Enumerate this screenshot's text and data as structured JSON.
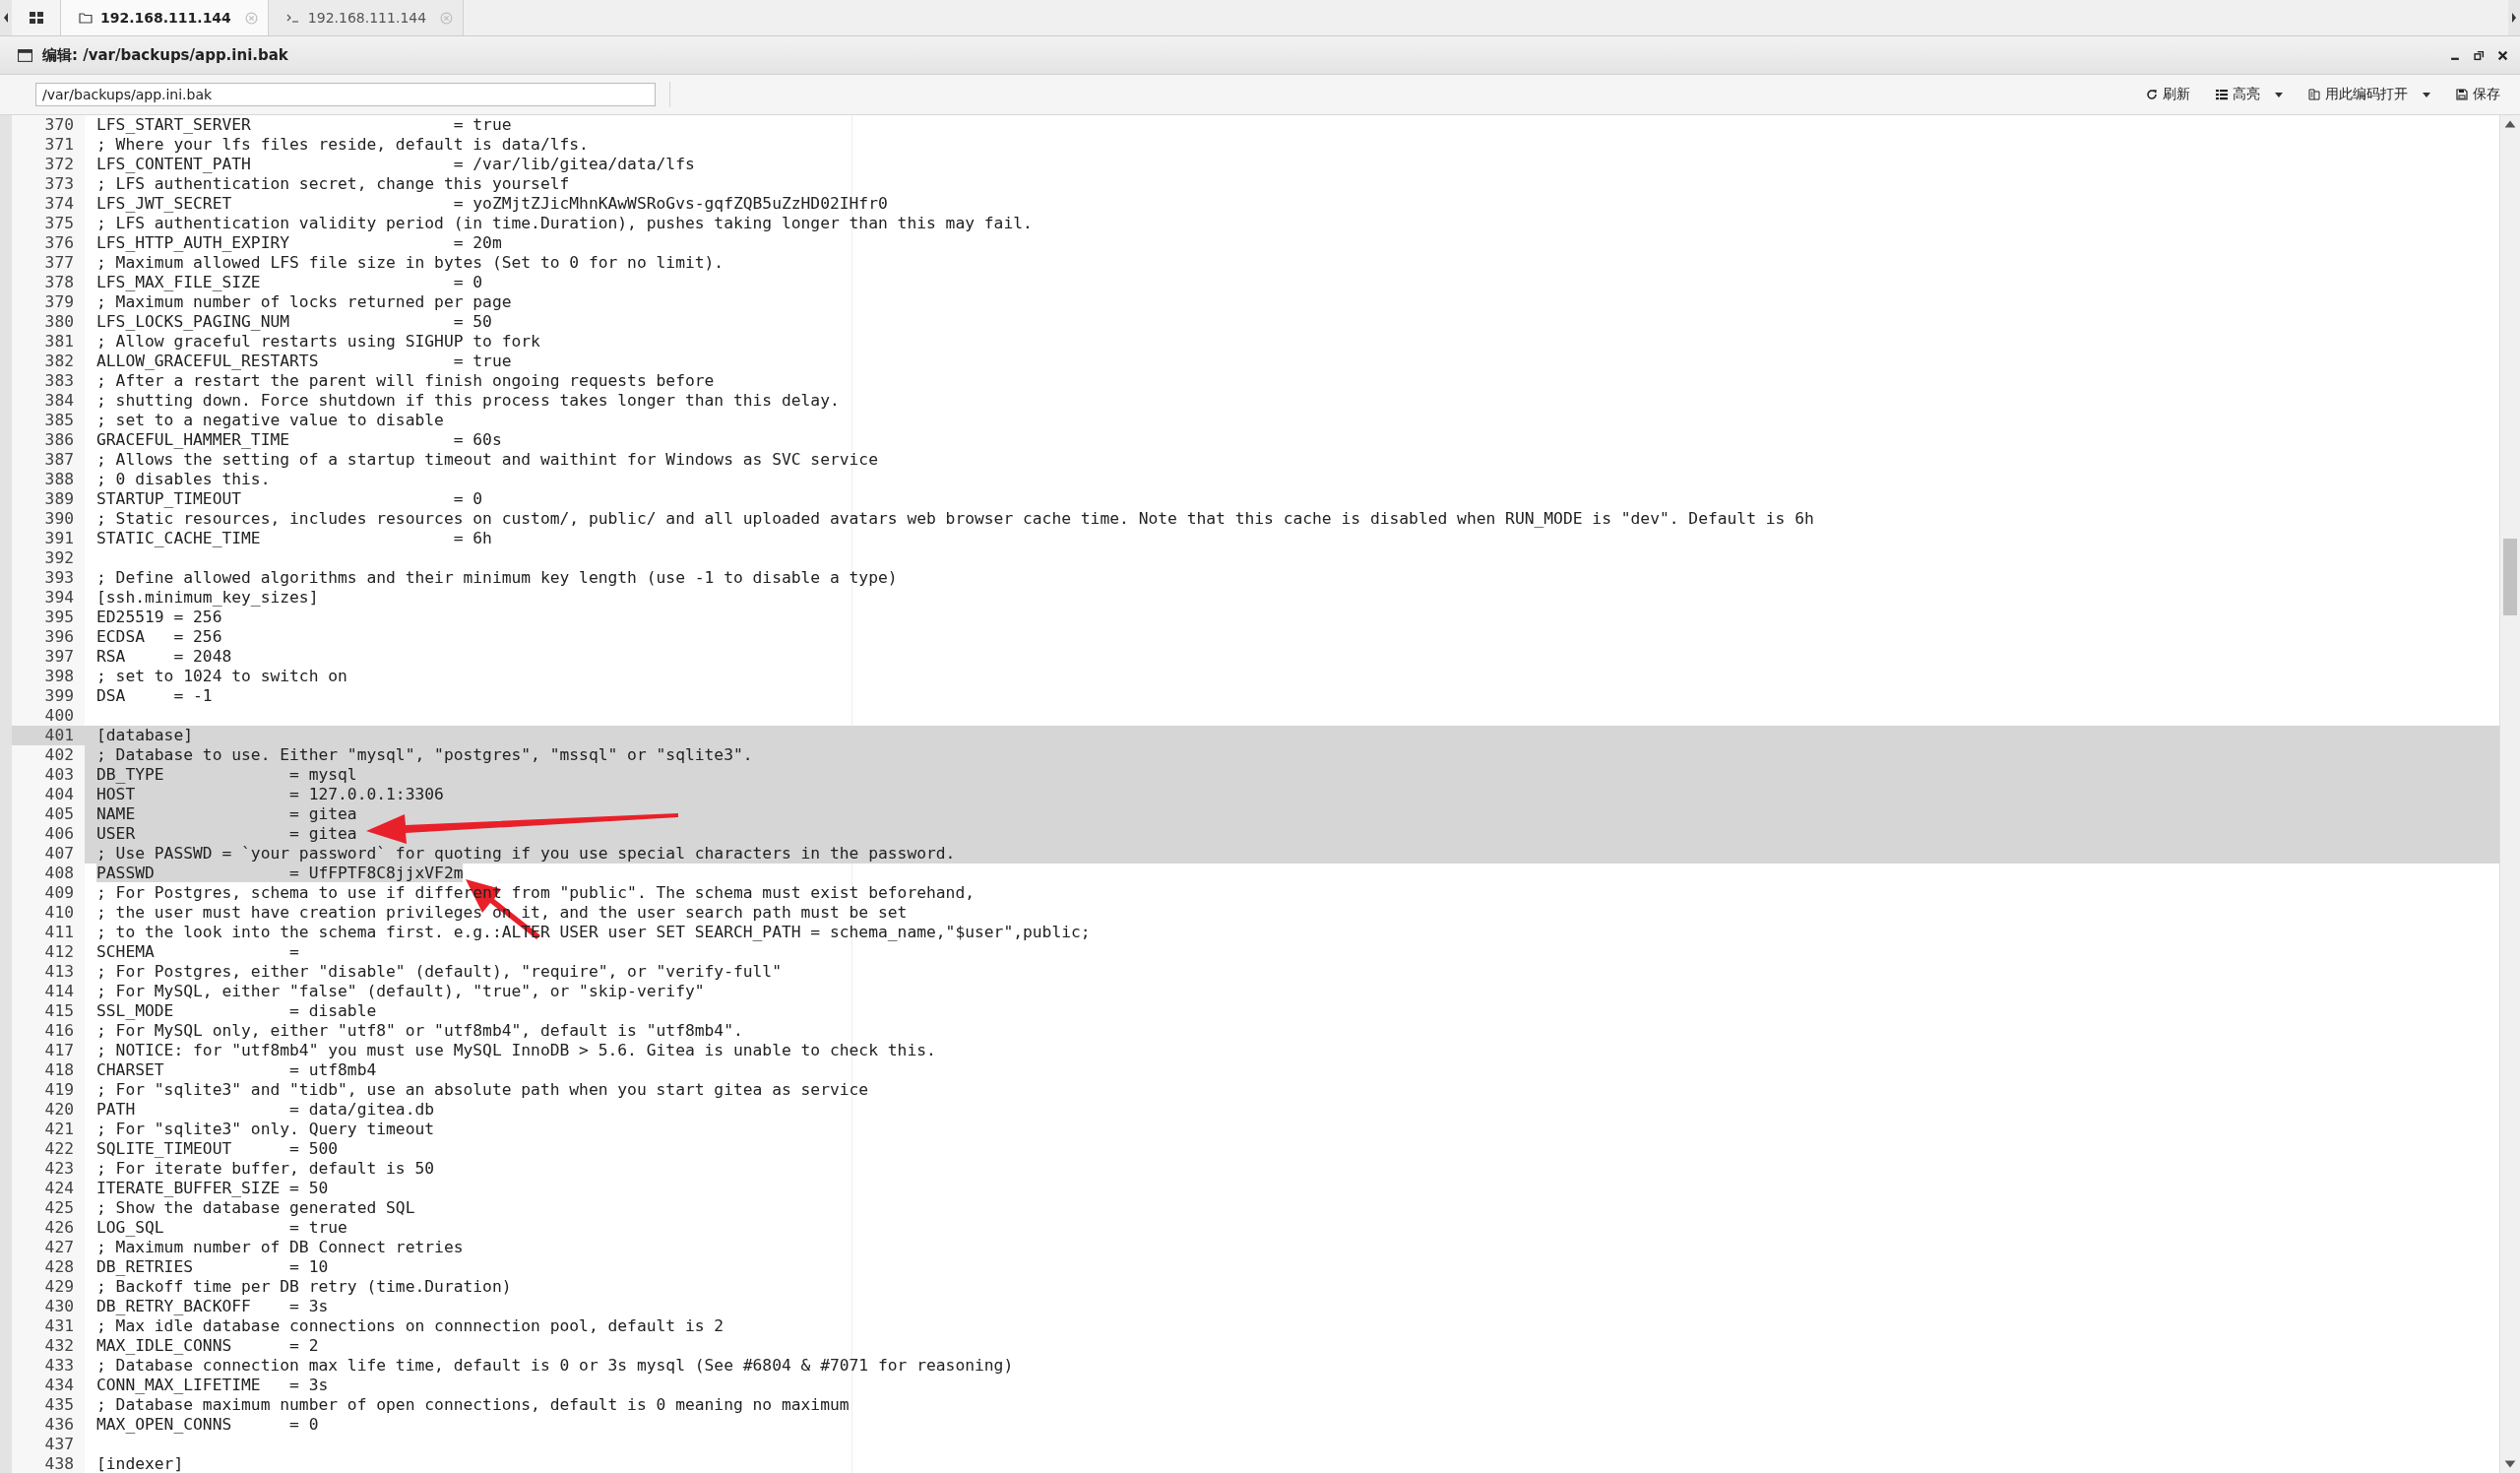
{
  "tabs": [
    {
      "label": "192.168.111.144",
      "kind": "folder",
      "selected": true
    },
    {
      "label": "192.168.111.144",
      "kind": "terminal",
      "selected": false
    }
  ],
  "window": {
    "title": "编辑: /var/backups/app.ini.bak"
  },
  "toolbar": {
    "path": "/var/backups/app.ini.bak",
    "buttons": [
      {
        "label": "刷新",
        "kind": "refresh",
        "dropdown": false
      },
      {
        "label": "高亮",
        "kind": "list",
        "dropdown": true
      },
      {
        "label": "用此编码打开",
        "kind": "encoding",
        "dropdown": true
      },
      {
        "label": "保存",
        "kind": "save",
        "dropdown": false
      }
    ]
  },
  "editor": {
    "lines": [
      {
        "number": "370",
        "text": "LFS_START_SERVER                     = true",
        "selected": false,
        "current": false
      },
      {
        "number": "371",
        "text": "; Where your lfs files reside, default is data/lfs.",
        "selected": false,
        "current": false
      },
      {
        "number": "372",
        "text": "LFS_CONTENT_PATH                     = /var/lib/gitea/data/lfs",
        "selected": false,
        "current": false
      },
      {
        "number": "373",
        "text": "; LFS authentication secret, change this yourself",
        "selected": false,
        "current": false
      },
      {
        "number": "374",
        "text": "LFS_JWT_SECRET                       = yoZMjtZJicMhnKAwWSRoGvs-gqfZQB5uZzHD02IHfr0",
        "selected": false,
        "current": false
      },
      {
        "number": "375",
        "text": "; LFS authentication validity period (in time.Duration), pushes taking longer than this may fail.",
        "selected": false,
        "current": false
      },
      {
        "number": "376",
        "text": "LFS_HTTP_AUTH_EXPIRY                 = 20m",
        "selected": false,
        "current": false
      },
      {
        "number": "377",
        "text": "; Maximum allowed LFS file size in bytes (Set to 0 for no limit).",
        "selected": false,
        "current": false
      },
      {
        "number": "378",
        "text": "LFS_MAX_FILE_SIZE                    = 0",
        "selected": false,
        "current": false
      },
      {
        "number": "379",
        "text": "; Maximum number of locks returned per page",
        "selected": false,
        "current": false
      },
      {
        "number": "380",
        "text": "LFS_LOCKS_PAGING_NUM                 = 50",
        "selected": false,
        "current": false
      },
      {
        "number": "381",
        "text": "; Allow graceful restarts using SIGHUP to fork",
        "selected": false,
        "current": false
      },
      {
        "number": "382",
        "text": "ALLOW_GRACEFUL_RESTARTS              = true",
        "selected": false,
        "current": false
      },
      {
        "number": "383",
        "text": "; After a restart the parent will finish ongoing requests before",
        "selected": false,
        "current": false
      },
      {
        "number": "384",
        "text": "; shutting down. Force shutdown if this process takes longer than this delay.",
        "selected": false,
        "current": false
      },
      {
        "number": "385",
        "text": "; set to a negative value to disable",
        "selected": false,
        "current": false
      },
      {
        "number": "386",
        "text": "GRACEFUL_HAMMER_TIME                 = 60s",
        "selected": false,
        "current": false
      },
      {
        "number": "387",
        "text": "; Allows the setting of a startup timeout and waithint for Windows as SVC service",
        "selected": false,
        "current": false
      },
      {
        "number": "388",
        "text": "; 0 disables this.",
        "selected": false,
        "current": false
      },
      {
        "number": "389",
        "text": "STARTUP_TIMEOUT                      = 0",
        "selected": false,
        "current": false
      },
      {
        "number": "390",
        "text": "; Static resources, includes resources on custom/, public/ and all uploaded avatars web browser cache time. Note that this cache is disabled when RUN_MODE is \"dev\". Default is 6h",
        "selected": false,
        "current": false
      },
      {
        "number": "391",
        "text": "STATIC_CACHE_TIME                    = 6h",
        "selected": false,
        "current": false
      },
      {
        "number": "392",
        "selected": false,
        "current": false
      },
      {
        "number": "393",
        "text": "; Define allowed algorithms and their minimum key length (use -1 to disable a type)",
        "selected": false,
        "current": false
      },
      {
        "number": "394",
        "text": "[ssh.minimum_key_sizes]",
        "selected": false,
        "current": false
      },
      {
        "number": "395",
        "text": "ED25519 = 256",
        "selected": false,
        "current": false
      },
      {
        "number": "396",
        "text": "ECDSA   = 256",
        "selected": false,
        "current": false
      },
      {
        "number": "397",
        "text": "RSA     = 2048",
        "selected": false,
        "current": false
      },
      {
        "number": "398",
        "text": "; set to 1024 to switch on",
        "selected": false,
        "current": false
      },
      {
        "number": "399",
        "text": "DSA     = -1",
        "selected": false,
        "current": false
      },
      {
        "number": "400",
        "selected": false,
        "current": false
      },
      {
        "number": "401",
        "text": "[database]",
        "selected": true,
        "current": true
      },
      {
        "number": "402",
        "text": "; Database to use. Either \"mysql\", \"postgres\", \"mssql\" or \"sqlite3\".",
        "selected": true,
        "current": false
      },
      {
        "number": "403",
        "text": "DB_TYPE             = mysql",
        "selected": true,
        "current": false
      },
      {
        "number": "404",
        "text": "HOST                = 127.0.0.1:3306",
        "selected": true,
        "current": false
      },
      {
        "number": "405",
        "text": "NAME                = gitea",
        "selected": true,
        "current": false
      },
      {
        "number": "406",
        "text": "USER                = gitea",
        "selected": true,
        "current": false
      },
      {
        "number": "407",
        "text": "; Use PASSWD = `your password` for quoting if you use special characters in the password.",
        "selected": true,
        "current": false
      },
      {
        "number": "408",
        "text": "PASSWD              = UfFPTF8C8jjxVF2m",
        "selected": true,
        "current": false
      },
      {
        "number": "409",
        "text": "; For Postgres, schema to use if different from \"public\". The schema must exist beforehand,",
        "selected": false,
        "current": false
      },
      {
        "number": "410",
        "text": "; the user must have creation privileges on it, and the user search path must be set",
        "selected": false,
        "current": false
      },
      {
        "number": "411",
        "text": "; to the look into the schema first. e.g.:ALTER USER user SET SEARCH_PATH = schema_name,\"$user\",public;",
        "selected": false,
        "current": false
      },
      {
        "number": "412",
        "text": "SCHEMA              =",
        "selected": false,
        "current": false
      },
      {
        "number": "413",
        "text": "; For Postgres, either \"disable\" (default), \"require\", or \"verify-full\"",
        "selected": false,
        "current": false
      },
      {
        "number": "414",
        "text": "; For MySQL, either \"false\" (default), \"true\", or \"skip-verify\"",
        "selected": false,
        "current": false
      },
      {
        "number": "415",
        "text": "SSL_MODE            = disable",
        "selected": false,
        "current": false
      },
      {
        "number": "416",
        "text": "; For MySQL only, either \"utf8\" or \"utf8mb4\", default is \"utf8mb4\".",
        "selected": false,
        "current": false
      },
      {
        "number": "417",
        "text": "; NOTICE: for \"utf8mb4\" you must use MySQL InnoDB > 5.6. Gitea is unable to check this.",
        "selected": false,
        "current": false
      },
      {
        "number": "418",
        "text": "CHARSET             = utf8mb4",
        "selected": false,
        "current": false
      },
      {
        "number": "419",
        "text": "; For \"sqlite3\" and \"tidb\", use an absolute path when you start gitea as service",
        "selected": false,
        "current": false
      },
      {
        "number": "420",
        "text": "PATH                = data/gitea.db",
        "selected": false,
        "current": false
      },
      {
        "number": "421",
        "text": "; For \"sqlite3\" only. Query timeout",
        "selected": false,
        "current": false
      },
      {
        "number": "422",
        "text": "SQLITE_TIMEOUT      = 500",
        "selected": false,
        "current": false
      },
      {
        "number": "423",
        "text": "; For iterate buffer, default is 50",
        "selected": false,
        "current": false
      },
      {
        "number": "424",
        "text": "ITERATE_BUFFER_SIZE = 50",
        "selected": false,
        "current": false
      },
      {
        "number": "425",
        "text": "; Show the database generated SQL",
        "selected": false,
        "current": false
      },
      {
        "number": "426",
        "text": "LOG_SQL             = true",
        "selected": false,
        "current": false
      },
      {
        "number": "427",
        "text": "; Maximum number of DB Connect retries",
        "selected": false,
        "current": false
      },
      {
        "number": "428",
        "text": "DB_RETRIES          = 10",
        "selected": false,
        "current": false
      },
      {
        "number": "429",
        "text": "; Backoff time per DB retry (time.Duration)",
        "selected": false,
        "current": false
      },
      {
        "number": "430",
        "text": "DB_RETRY_BACKOFF    = 3s",
        "selected": false,
        "current": false
      },
      {
        "number": "431",
        "text": "; Max idle database connections on connnection pool, default is 2",
        "selected": false,
        "current": false
      },
      {
        "number": "432",
        "text": "MAX_IDLE_CONNS      = 2",
        "selected": false,
        "current": false
      },
      {
        "number": "433",
        "text": "; Database connection max life time, default is 0 or 3s mysql (See #6804 & #7071 for reasoning)",
        "selected": false,
        "current": false
      },
      {
        "number": "434",
        "text": "CONN_MAX_LIFETIME   = 3s",
        "selected": false,
        "current": false
      },
      {
        "number": "435",
        "text": "; Database maximum number of open connections, default is 0 meaning no maximum",
        "selected": false,
        "current": false
      },
      {
        "number": "436",
        "text": "MAX_OPEN_CONNS      = 0",
        "selected": false,
        "current": false
      },
      {
        "number": "437",
        "selected": false,
        "current": false
      },
      {
        "number": "438",
        "text": "[indexer]",
        "selected": false,
        "current": false
      }
    ]
  }
}
